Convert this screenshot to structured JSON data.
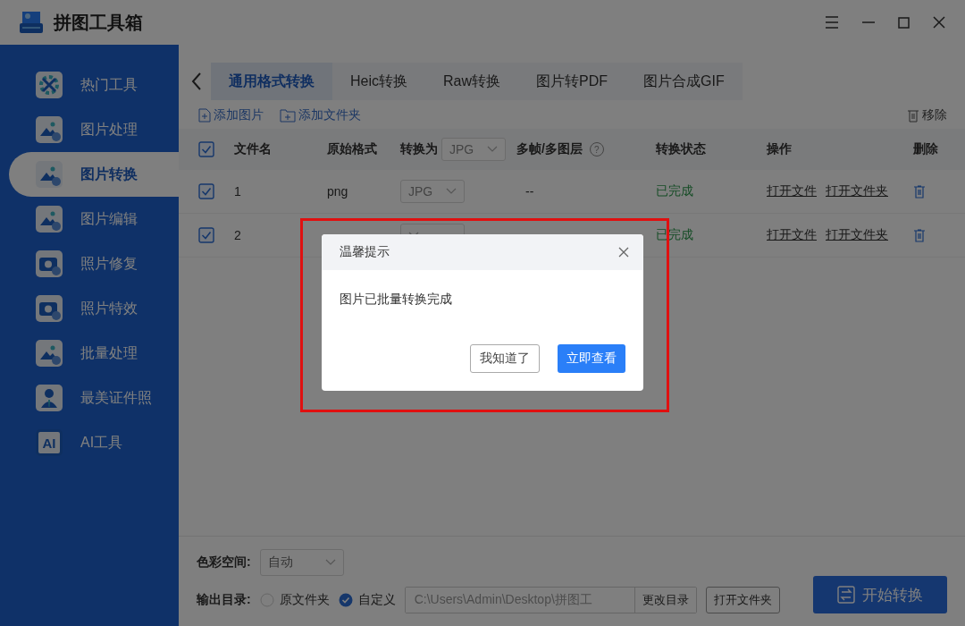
{
  "app": {
    "title": "拼图工具箱"
  },
  "sidebar": {
    "items": [
      {
        "label": "热门工具",
        "kind": "tools",
        "selected": false
      },
      {
        "label": "图片处理",
        "kind": "image",
        "selected": false
      },
      {
        "label": "图片转换",
        "kind": "image",
        "selected": true
      },
      {
        "label": "图片编辑",
        "kind": "image",
        "selected": false
      },
      {
        "label": "照片修复",
        "kind": "camera",
        "selected": false
      },
      {
        "label": "照片特效",
        "kind": "camera",
        "selected": false
      },
      {
        "label": "批量处理",
        "kind": "image",
        "selected": false
      },
      {
        "label": "最美证件照",
        "kind": "person",
        "selected": false
      },
      {
        "label": "AI工具",
        "kind": "ai",
        "icon_text": "AI",
        "selected": false
      }
    ]
  },
  "tabs": [
    {
      "label": "通用格式转换",
      "selected": true
    },
    {
      "label": "Heic转换",
      "selected": false
    },
    {
      "label": "Raw转换",
      "selected": false
    },
    {
      "label": "图片转PDF",
      "selected": false
    },
    {
      "label": "图片合成GIF",
      "selected": false
    }
  ],
  "toolbar": {
    "add_image": "添加图片",
    "add_folder": "添加文件夹",
    "remove": "移除"
  },
  "table": {
    "all_checked": true,
    "columns": [
      {
        "label": "文件名"
      },
      {
        "label": "原始格式"
      },
      {
        "label": "转换为",
        "select": "JPG"
      },
      {
        "label": "多帧/多图层",
        "help": "?"
      },
      {
        "label": "转换状态"
      },
      {
        "label": "操作"
      },
      {
        "label": "删除"
      }
    ],
    "rows": [
      {
        "checked": true,
        "name": "1",
        "format": "png",
        "target": "JPG",
        "frames": "--",
        "status": "已完成",
        "actions": [
          "打开文件",
          "打开文件夹"
        ]
      },
      {
        "checked": true,
        "name": "2",
        "status": "已完成",
        "actions": [
          "打开文件",
          "打开文件夹"
        ]
      }
    ]
  },
  "settings": {
    "color_space_label": "色彩空间:",
    "color_space": "自动",
    "output_label": "输出目录:",
    "output_options": [
      {
        "label": "原文件夹",
        "selected": false
      },
      {
        "label": "自定义",
        "selected": true
      }
    ],
    "path": "C:\\Users\\Admin\\Desktop\\拼图工",
    "change_dir": "更改目录",
    "open_folder": "打开文件夹",
    "start": "开始转换"
  },
  "dialog": {
    "title": "温馨提示",
    "message": "图片已批量转换完成",
    "buttons": [
      {
        "label": "我知道了",
        "kind": "secondary"
      },
      {
        "label": "立即查看",
        "kind": "primary"
      }
    ]
  }
}
